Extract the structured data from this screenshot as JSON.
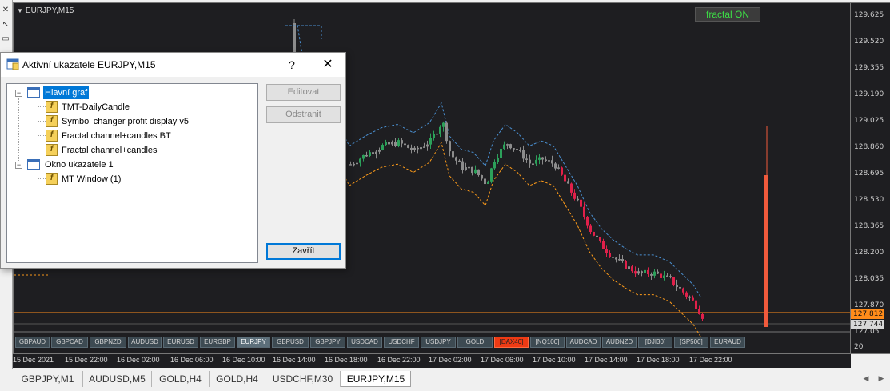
{
  "chart": {
    "title": "EURJPY,M15",
    "fractal_badge": "fractal ON",
    "price_labels": [
      "129.625",
      "129.520",
      "129.355",
      "129.190",
      "129.025",
      "128.860",
      "128.695",
      "128.530",
      "128.365",
      "128.200",
      "128.035",
      "127.870"
    ],
    "current_price": "127.812",
    "bid_price": "127.744",
    "indicator_window": {
      "top_label": "127.05",
      "bottom_label": "20"
    },
    "time_labels": [
      "15 Dec 2021",
      "15 Dec 22:00",
      "16 Dec 02:00",
      "16 Dec 06:00",
      "16 Dec 10:00",
      "16 Dec 14:00",
      "16 Dec 18:00",
      "16 Dec 22:00",
      "17 Dec 02:00",
      "17 Dec 06:00",
      "17 Dec 10:00",
      "17 Dec 14:00",
      "17 Dec 18:00",
      "17 Dec 22:00"
    ],
    "symbols": [
      "GBPAUD",
      "GBPCAD",
      "GBPNZD",
      "AUDUSD",
      "EURUSD",
      "EURGBP",
      "EURJPY",
      "GBPUSD",
      "GBPJPY",
      "USDCAD",
      "USDCHF",
      "USDJPY",
      "GOLD",
      "[DAX40]",
      "[NQ100]",
      "AUDCAD",
      "AUDNZD",
      "[DJI30]",
      "[SP500]",
      "EURAUD"
    ],
    "active_symbol": "EURJPY",
    "highlighted_symbol": "[DAX40]",
    "colors": {
      "bull": "#2ca05a",
      "bear": "#e0204a",
      "neutral": "#8c8c8c",
      "upper_channel": "#4a8fd0",
      "lower_channel": "#ff9c1a",
      "price_line": "#ff8c1a",
      "histogram": "#f05a3c"
    }
  },
  "dialog": {
    "title": "Aktivní ukazatele EURJPY,M15",
    "help": "?",
    "close": "✕",
    "tree": {
      "main_chart": "Hlavní graf",
      "main_indicators": [
        "TMT-DailyCandle",
        "Symbol changer profit display v5",
        "Fractal channel+candles BT",
        "Fractal channel+candles"
      ],
      "subwindow": "Okno ukazatele 1",
      "subwindow_indicators": [
        "MT Window (1)"
      ]
    },
    "buttons": {
      "edit": "Editovat",
      "remove": "Odstranit",
      "close": "Zavřít"
    }
  },
  "tabs": [
    "GBPJPY,M1",
    "AUDUSD,M5",
    "GOLD,H4",
    "GOLD,H4",
    "USDCHF,M30",
    "EURJPY,M15"
  ],
  "active_tab": "EURJPY,M15"
}
